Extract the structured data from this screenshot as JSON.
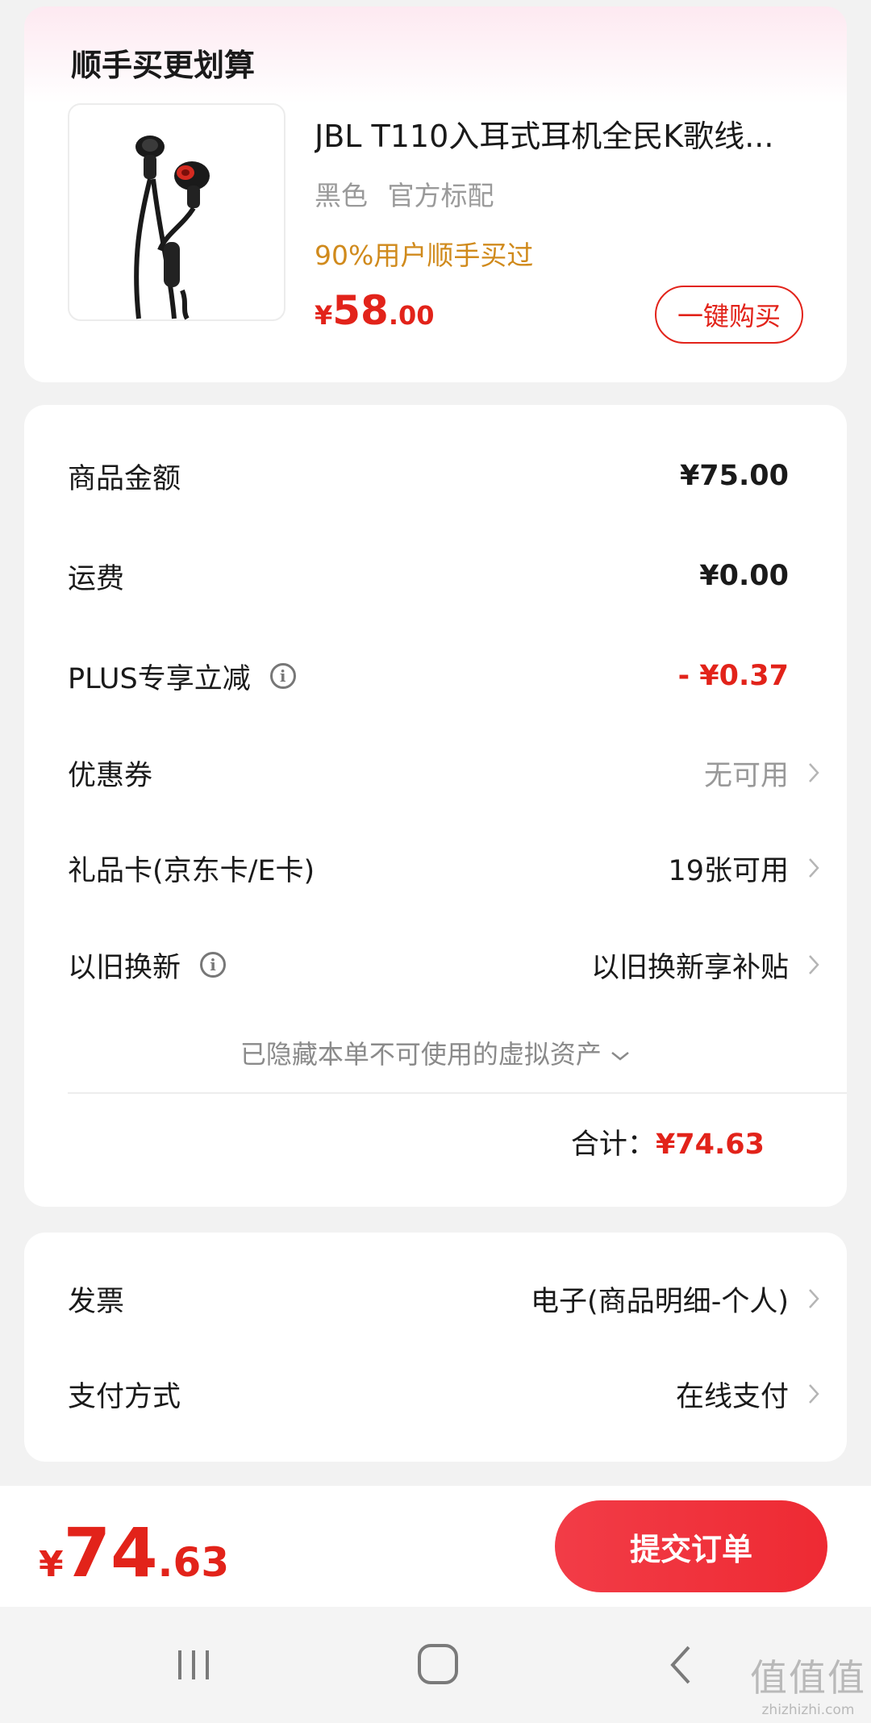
{
  "upsell": {
    "title": "顺手买更划算",
    "product": {
      "name": "JBL T110入耳式耳机全民K歌线...",
      "spec": "黑色 官方标配",
      "social_proof": "90%用户顺手买过",
      "price_currency": "¥",
      "price_int": "58",
      "price_dec": ".00",
      "image_icon": "earphones-product-image"
    },
    "buy_button": "一键购买"
  },
  "summary": {
    "goods_amount_label": "商品金额",
    "goods_amount_value": "¥75.00",
    "shipping_label": "运费",
    "shipping_value": "¥0.00",
    "plus_discount_label": "PLUS专享立减",
    "plus_discount_value": "- ¥0.37",
    "coupon_label": "优惠券",
    "coupon_value": "无可用",
    "giftcard_label": "礼品卡(京东卡/E卡)",
    "giftcard_value": "19张可用",
    "tradein_label": "以旧换新",
    "tradein_value": "以旧换新享补贴",
    "hidden_assets_text": "已隐藏本单不可使用的虚拟资产",
    "total_label": "合计：",
    "total_value": "¥74.63"
  },
  "invoice": {
    "invoice_label": "发票",
    "invoice_value": "电子(商品明细-个人)",
    "payment_label": "支付方式",
    "payment_value": "在线支付"
  },
  "bottom_bar": {
    "currency": "¥",
    "total_int": "74",
    "total_dec": ".63",
    "submit_label": "提交订单"
  },
  "watermark": {
    "big": "值值值",
    "small": "zhizhizhi.com"
  },
  "colors": {
    "accent_red": "#e2231a",
    "social_proof_orange": "#d08a1c",
    "muted_gray": "#999999"
  }
}
